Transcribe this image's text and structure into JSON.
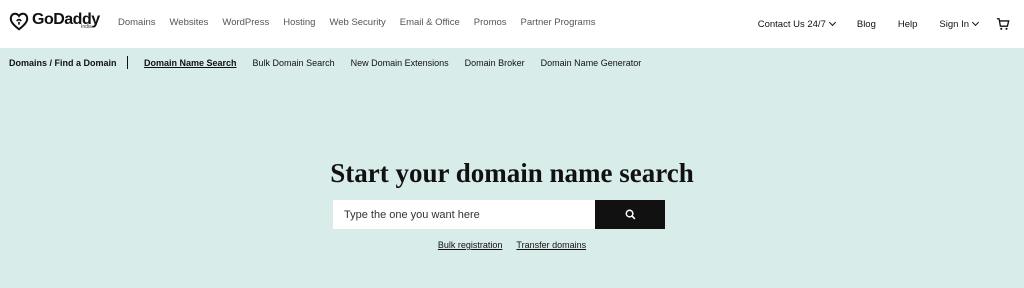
{
  "brand": {
    "name": "GoDaddy",
    "region": "India"
  },
  "mainnav": [
    "Domains",
    "Websites",
    "WordPress",
    "Hosting",
    "Web Security",
    "Email & Office",
    "Promos",
    "Partner Programs"
  ],
  "rightnav": {
    "contact": "Contact Us 24/7",
    "blog": "Blog",
    "help": "Help",
    "signin": "Sign In",
    "cart_icon": "cart-icon"
  },
  "subnav": {
    "breadcrumb": "Domains / Find a Domain",
    "items": [
      "Domain Name Search",
      "Bulk Domain Search",
      "New Domain Extensions",
      "Domain Broker",
      "Domain Name Generator"
    ],
    "active_index": 0
  },
  "hero": {
    "title": "Start your domain name search",
    "placeholder": "Type the one you want here",
    "value": "",
    "search_icon": "search-icon"
  },
  "links": [
    "Bulk registration",
    "Transfer domains"
  ],
  "colors": {
    "background": "#d8ecea",
    "button": "#111111",
    "topbar": "#ffffff"
  }
}
